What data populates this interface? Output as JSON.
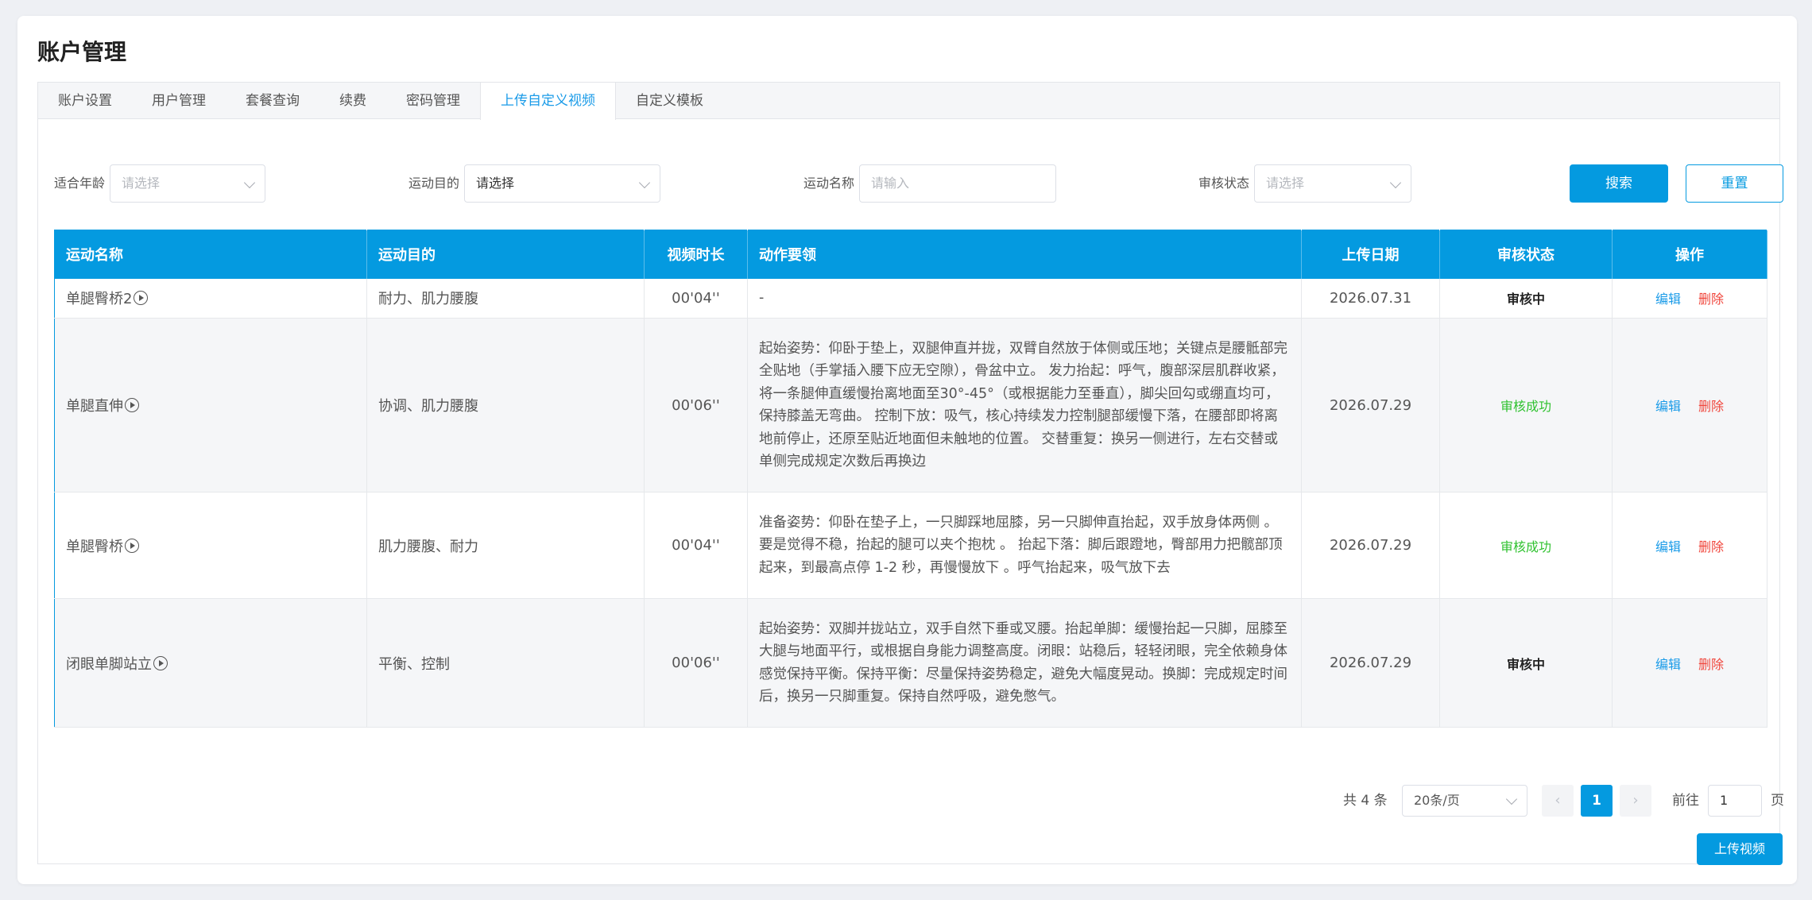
{
  "page": {
    "title": "账户管理"
  },
  "tabs": [
    {
      "label": "账户设置"
    },
    {
      "label": "用户管理"
    },
    {
      "label": "套餐查询"
    },
    {
      "label": "续费"
    },
    {
      "label": "密码管理"
    },
    {
      "label": "上传自定义视频",
      "active": true
    },
    {
      "label": "自定义模板"
    }
  ],
  "filters": {
    "age": {
      "label": "适合年龄",
      "placeholder": "请选择"
    },
    "purpose": {
      "label": "运动目的",
      "value": "请选择"
    },
    "name": {
      "label": "运动名称",
      "placeholder": "请输入"
    },
    "status": {
      "label": "审核状态",
      "placeholder": "请选择"
    },
    "search_label": "搜索",
    "reset_label": "重置"
  },
  "table": {
    "headers": [
      "运动名称",
      "运动目的",
      "视频时长",
      "动作要领",
      "上传日期",
      "审核状态",
      "操作"
    ],
    "edit_label": "编辑",
    "delete_label": "删除",
    "rows": [
      {
        "name": "单腿臀桥2",
        "purpose": "耐力、肌力腰腹",
        "duration": "00'04''",
        "desc": "-",
        "date": "2026.07.31",
        "status": "审核中"
      },
      {
        "name": "单腿直伸",
        "purpose": "协调、肌力腰腹",
        "duration": "00'06''",
        "desc": "起始姿势：仰卧于垫上，双腿伸直并拢，双臂自然放于体侧或压地；关键点是腰骶部完全贴地（手掌插入腰下应无空隙），骨盆中立。 发力抬起：呼气，腹部深层肌群收紧，将一条腿伸直缓慢抬离地面至30°-45°（或根据能力至垂直），脚尖回勾或绷直均可，保持膝盖无弯曲。 控制下放：吸气，核心持续发力控制腿部缓慢下落，在腰部即将离地前停止，还原至贴近地面但未触地的位置。 交替重复：换另一侧进行，左右交替或单侧完成规定次数后再换边",
        "date": "2026.07.29",
        "status": "审核成功"
      },
      {
        "name": "单腿臀桥",
        "purpose": "肌力腰腹、耐力",
        "duration": "00'04''",
        "desc": "准备姿势：仰卧在垫子上，一只脚踩地屈膝，另一只脚伸直抬起，双手放身体两侧 。要是觉得不稳，抬起的腿可以夹个抱枕 。 抬起下落：脚后跟蹬地，臀部用力把髋部顶起来，到最高点停 1-2 秒，再慢慢放下 。呼气抬起来，吸气放下去",
        "date": "2026.07.29",
        "status": "审核成功"
      },
      {
        "name": "闭眼单脚站立",
        "purpose": "平衡、控制",
        "duration": "00'06''",
        "desc": "起始姿势：双脚并拢站立，双手自然下垂或叉腰。抬起单脚：缓慢抬起一只脚，屈膝至大腿与地面平行，或根据自身能力调整高度。闭眼：站稳后，轻轻闭眼，完全依赖身体感觉保持平衡。保持平衡：尽量保持姿势稳定，避免大幅度晃动。换脚：完成规定时间后，换另一只脚重复。保持自然呼吸，避免憋气。",
        "date": "2026.07.29",
        "status": "审核中"
      }
    ]
  },
  "pager": {
    "total": "共 4 条",
    "page_size": "20条/页",
    "current": "1",
    "goto_label": "前往",
    "goto_value": "1",
    "page_suffix": "页"
  },
  "upload_label": "上传视频",
  "colors": {
    "primary": "#049ae0",
    "success": "#2fc22f",
    "danger": "#f0463c"
  }
}
